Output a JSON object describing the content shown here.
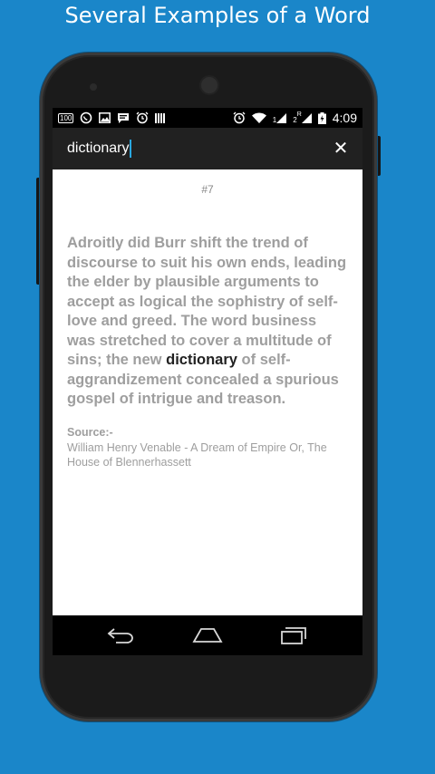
{
  "headline": "Several Examples of a Word",
  "status_bar": {
    "left_icons": [
      "battery-100-icon",
      "whatsapp-icon",
      "gallery-icon",
      "chat-icon",
      "alarm-icon",
      "barcode-icon"
    ],
    "right_icons": [
      "alarm-icon",
      "wifi-icon",
      "signal-1-icon",
      "signal-2-roaming-icon",
      "battery-charging-icon"
    ],
    "sim1_label": "1",
    "sim2_label": "2",
    "roaming_label": "R",
    "battery_text": "100",
    "time": "4:09"
  },
  "search": {
    "value": "dictionary",
    "close_icon": "close-icon"
  },
  "example": {
    "counter": "#7",
    "quote_before": "Adroitly did Burr shift the trend of discourse to suit his own ends, leading the elder by plausible arguments to accept as logical the sophistry of self-love and greed. The word business was stretched to cover a multitude of sins; the new ",
    "highlight": "dictionary",
    "quote_after": " of self-aggrandizement concealed a spurious gospel of intrigue and treason.",
    "source_label": "Source:-",
    "source_text": "William Henry Venable - A Dream of Empire Or, The House of Blennerhassett"
  },
  "navbar": [
    "back-icon",
    "home-icon",
    "recents-icon"
  ],
  "colors": {
    "background": "#1a86c9",
    "search_bar": "#212121",
    "caret": "#29a7e0",
    "quote_text": "#9e9e9e",
    "highlight_text": "#222222"
  }
}
